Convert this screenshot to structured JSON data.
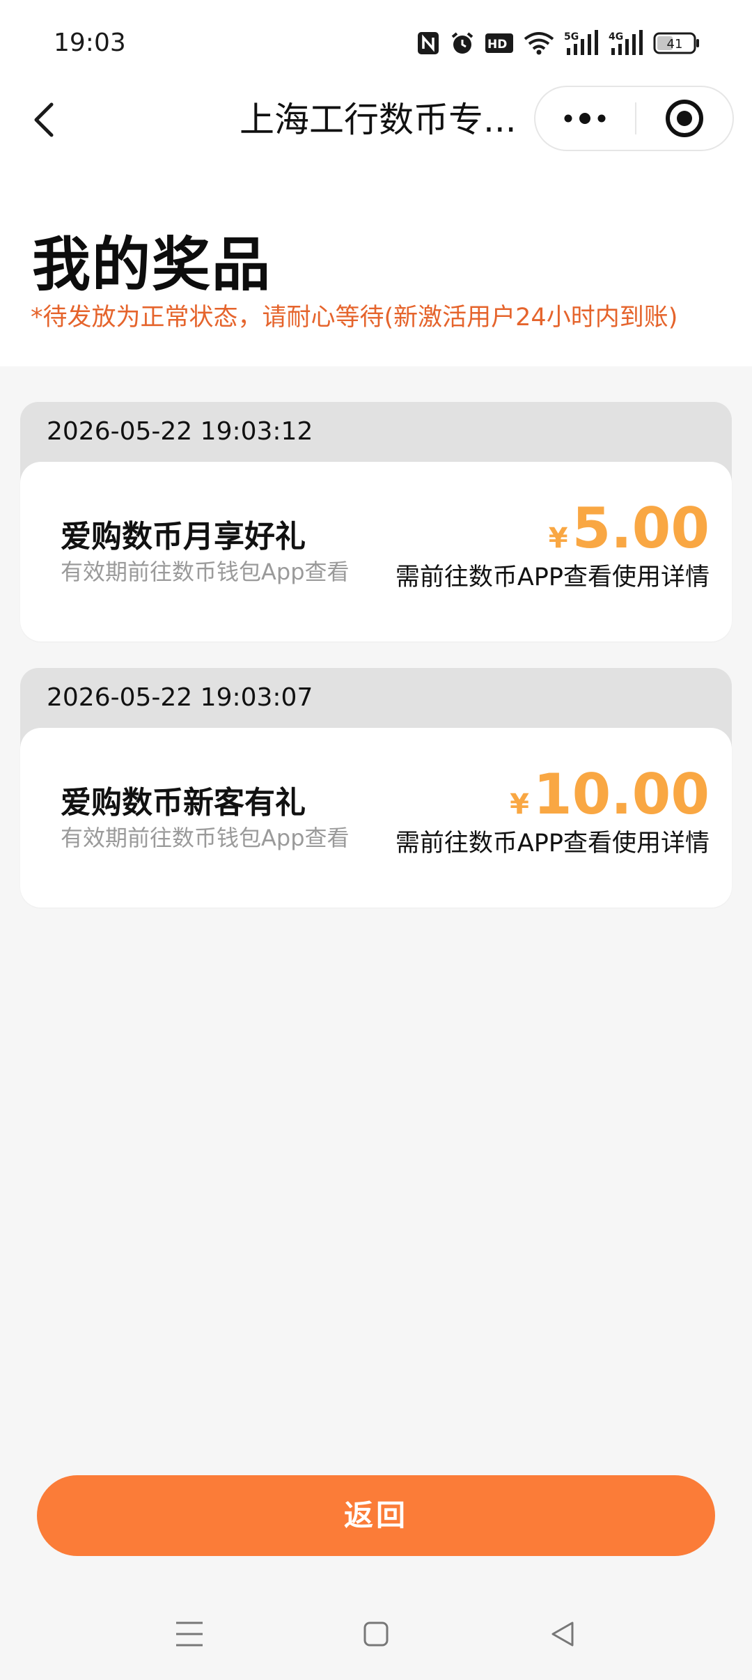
{
  "status_bar": {
    "time": "19:03",
    "battery_level": "41",
    "signal_5g": "5G",
    "signal_4g": "4G",
    "hd_badge": "HD"
  },
  "nav": {
    "title": "上海工行数币专..."
  },
  "header": {
    "title": "我的奖品",
    "notice": "*待发放为正常状态，请耐心等待(新激活用户24小时内到账)"
  },
  "prizes": [
    {
      "date": "2026-05-22 19:03:12",
      "name": "爱购数币月享好礼",
      "validity": "有效期前往数币钱包App查看",
      "currency": "¥",
      "amount": "5.00",
      "tip": "需前往数币APP查看使用详情"
    },
    {
      "date": "2026-05-22 19:03:07",
      "name": "爱购数币新客有礼",
      "validity": "有效期前往数币钱包App查看",
      "currency": "¥",
      "amount": "10.00",
      "tip": "需前往数币APP查看使用详情"
    }
  ],
  "footer": {
    "return_label": "返回"
  },
  "colors": {
    "accent_orange": "#fb7c38",
    "amount_orange": "#f9a743",
    "notice_red": "#e5642c"
  },
  "icons": {
    "back": "back-arrow-icon",
    "more": "more-dots-icon",
    "close": "target-close-icon",
    "nav_menu": "menu-lines-icon",
    "nav_home": "home-square-icon",
    "nav_back": "triangle-back-icon"
  }
}
